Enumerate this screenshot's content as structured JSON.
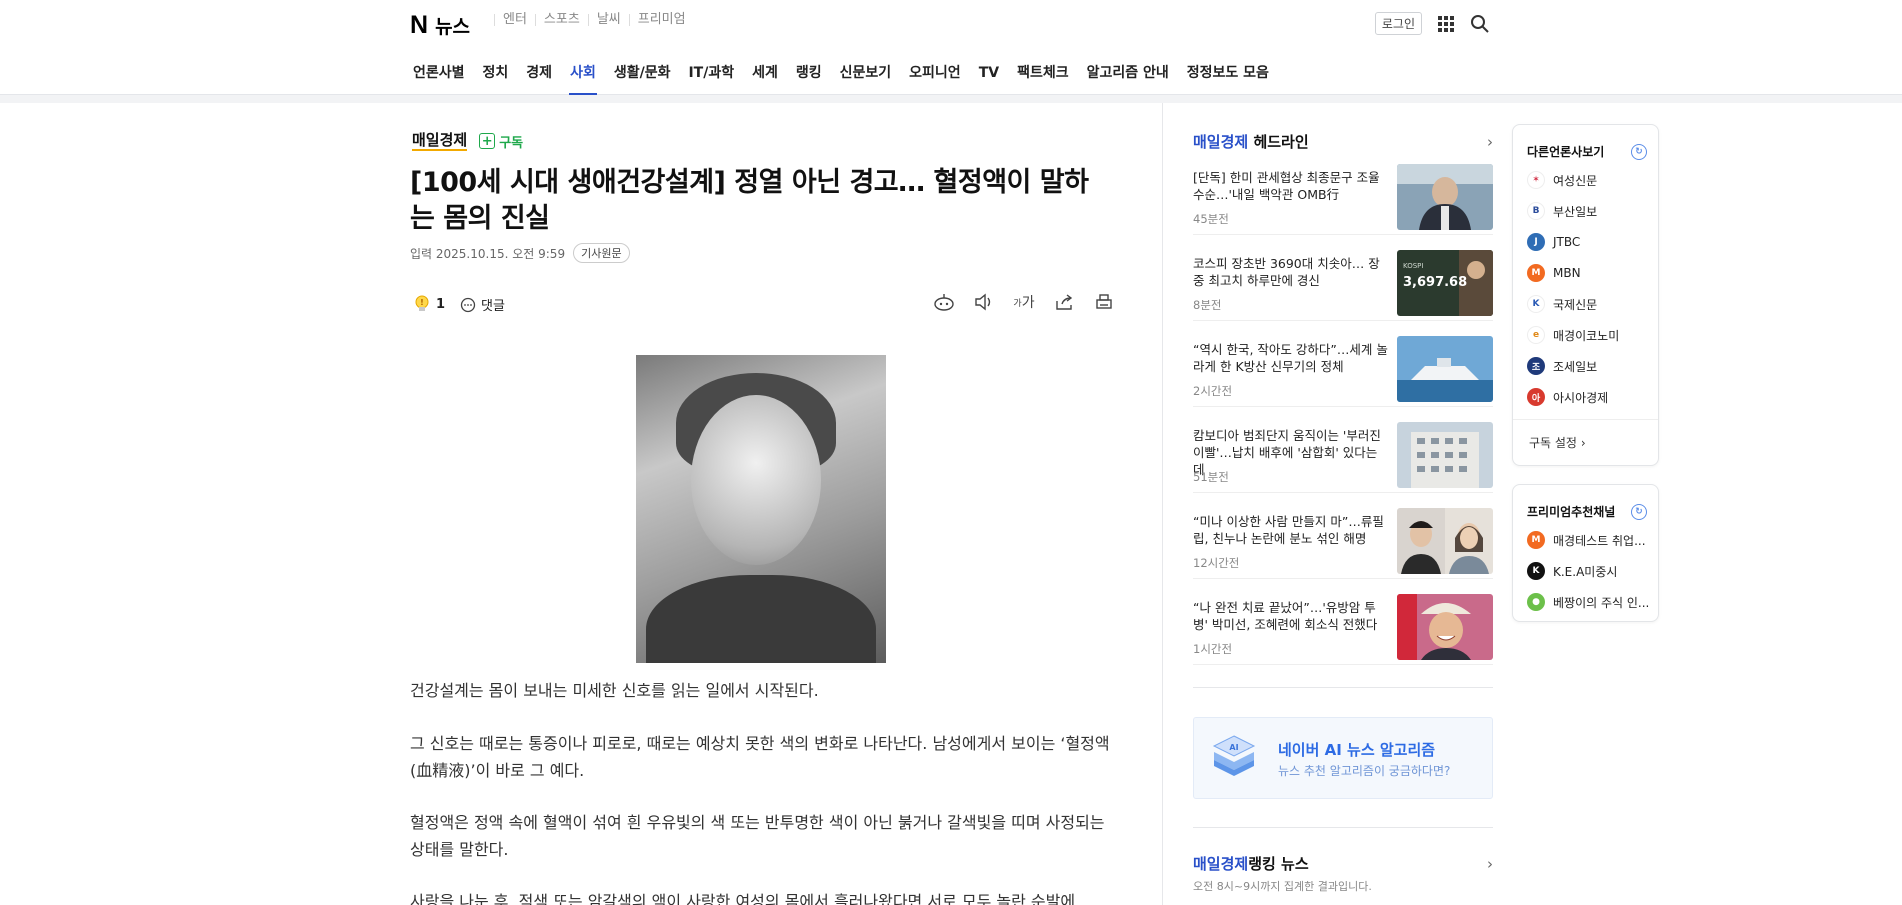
{
  "header": {
    "logo_n": "N",
    "logo_news": "뉴스",
    "services": [
      "엔터",
      "스포츠",
      "날씨",
      "프리미엄"
    ],
    "login": "로그인",
    "nav": [
      "언론사별",
      "정치",
      "경제",
      "사회",
      "생활/문화",
      "IT/과학",
      "세계",
      "랭킹",
      "신문보기",
      "오피니언",
      "TV",
      "팩트체크",
      "알고리즘 안내",
      "정정보도 모음"
    ],
    "active_nav": "사회"
  },
  "article": {
    "press": "매일경제",
    "subscribe": "구독",
    "title": "[100세 시대 생애건강설계] 정열 아닌 경고… 혈정액이 말하는 몸의 진실",
    "date": "입력 2025.10.15. 오전 9:59",
    "original_button": "기사원문",
    "reaction_count": "1",
    "comment_label": "댓글",
    "font_size_label": "가",
    "paragraphs": [
      "건강설계는 몸이 보내는 미세한 신호를 읽는 일에서 시작된다.",
      "그 신호는 때로는 통증이나 피로로, 때로는 예상치 못한 색의 변화로 나타난다. 남성에게서 보이는 ‘혈정액(血精液)’이 바로 그 예다.",
      "혈정액은 정액 속에 혈액이 섞여 흰 우유빛의 색 또는 반투명한 색이 아닌 붉거나 갈색빛을 띠며 사정되는 상태를 말한다.",
      "사랑을 나눈 후, 적색 또는 암갈색의 액이 사랑한 여성의 몸에서 흘러나왔다면 서로 모두 놀란 순발에"
    ]
  },
  "headlines": {
    "press": "매일경제",
    "label": "헤드라인",
    "items": [
      {
        "title": "[단독] 한미 관세협상 최종문구 조율 수순…'내일 백악관 OMB行",
        "time": "45분전"
      },
      {
        "title": "코스피 장초반 3690대 치솟아… 장중 최고치 하루만에 경신",
        "time": "8분전"
      },
      {
        "title": "“역시 한국, 작아도 강하다”…세계 놀라게 한 K방산 신무기의 정체",
        "time": "2시간전"
      },
      {
        "title": "캄보디아 범죄단지 움직이는 '부러진 이빨'…납치 배후에 '삼합회' 있다는데",
        "time": "51분전"
      },
      {
        "title": "“미나 이상한 사람 만들지 마”…류필립, 친누나 논란에 분노 섞인 해명",
        "time": "12시간전"
      },
      {
        "title": "“나 완전 치료 끝났어”…'유방암 투병' 박미선, 조혜련에 회소식 전했다",
        "time": "1시간전"
      }
    ],
    "kospi_label": "KOSPI",
    "kospi_value": "3,697.68"
  },
  "ai_box": {
    "icon_text": "AI",
    "title": "네이버 AI 뉴스 알고리즘",
    "subtitle": "뉴스 추천 알고리즘이 궁금하다면?"
  },
  "ranking": {
    "press": "매일경제",
    "label": "랭킹 뉴스",
    "subtitle": "오전 8시~9시까지 집계한 결과입니다."
  },
  "other_press": {
    "title": "다른언론사보기",
    "items": [
      "여성신문",
      "부산일보",
      "JTBC",
      "MBN",
      "국제신문",
      "매경이코노미",
      "조세일보",
      "아시아경제"
    ],
    "footer": "구독 설정"
  },
  "premium": {
    "title": "프리미엄추천채널",
    "items": [
      "매경테스트 취업...",
      "K.E.A미중시",
      "베짱이의 주식 인..."
    ]
  }
}
